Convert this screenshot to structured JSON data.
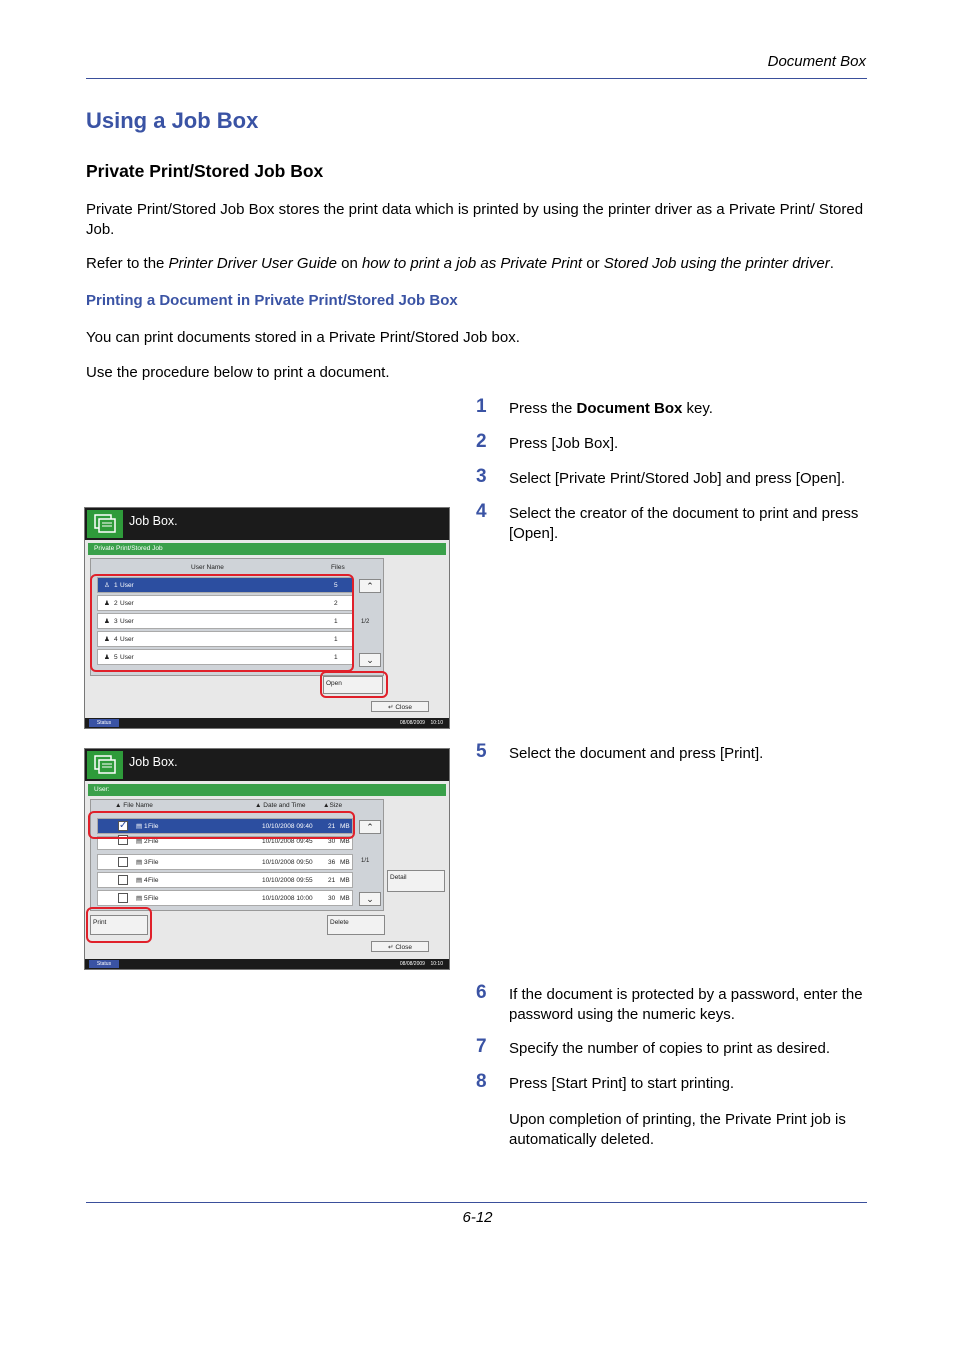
{
  "header": {
    "section": "Document Box"
  },
  "title": "Using a Job Box",
  "subtitle": "Private Print/Stored Job Box",
  "intro": "Private Print/Stored Job Box stores the print data which is printed by using the printer driver as a Private Print/ Stored Job.",
  "refer": {
    "t1": "Refer to the ",
    "guide": "Printer Driver User Guide",
    "t2": " on ",
    "how": "how to print a job as Private Print",
    "t3": " or ",
    "stored": "Stored Job using the printer driver",
    "t4": "."
  },
  "subheading": "Printing a Document in Private Print/Stored Job Box",
  "para1": "You can print documents stored in a Private Print/Stored Job box.",
  "para2": "Use the procedure below to print a document.",
  "steps": [
    {
      "num": "1",
      "pre": "Press the ",
      "bold": "Document Box",
      "post": " key."
    },
    {
      "num": "2",
      "text": "Press [Job Box]."
    },
    {
      "num": "3",
      "text": "Select [Private Print/Stored Job] and press [Open]."
    },
    {
      "num": "4",
      "text": "Select the creator of the document to print and press [Open]."
    },
    {
      "num": "5",
      "text": "Select the document and press [Print]."
    },
    {
      "num": "6",
      "text": "If the document is protected by a password, enter the password using the numeric keys."
    },
    {
      "num": "7",
      "text": "Specify the number of copies to print as desired."
    },
    {
      "num": "8",
      "text": "Press [Start Print] to start printing."
    }
  ],
  "step8_note": "Upon completion of printing, the Private Print job is automatically deleted.",
  "screen1": {
    "title": "Job Box.",
    "bar": "Private Print/Stored Job",
    "col_user": "User Name",
    "col_files": "Files",
    "rows": [
      {
        "num": "1",
        "name": "User",
        "files": "5"
      },
      {
        "num": "2",
        "name": "User",
        "files": "2"
      },
      {
        "num": "3",
        "name": "User",
        "files": "1"
      },
      {
        "num": "4",
        "name": "User",
        "files": "1"
      },
      {
        "num": "5",
        "name": "User",
        "files": "1"
      }
    ],
    "page": "1/2",
    "open": "Open",
    "close": "Close",
    "status": "Status",
    "date": "08/08/2009",
    "time": "10:10"
  },
  "screen2": {
    "title": "Job Box.",
    "bar": "User:",
    "col_name": "File Name",
    "col_date": "Date and Time",
    "col_size": "Size",
    "rows": [
      {
        "num": "1",
        "name": "File",
        "date": "10/10/2008 09:40",
        "size": "21",
        "unit": "MB"
      },
      {
        "num": "2",
        "name": "File",
        "date": "10/10/2008 09:45",
        "size": "30",
        "unit": "MB"
      },
      {
        "num": "3",
        "name": "File",
        "date": "10/10/2008 09:50",
        "size": "36",
        "unit": "MB"
      },
      {
        "num": "4",
        "name": "File",
        "date": "10/10/2008 09:55",
        "size": "21",
        "unit": "MB"
      },
      {
        "num": "5",
        "name": "File",
        "date": "10/10/2008 10:00",
        "size": "30",
        "unit": "MB"
      }
    ],
    "page": "1/1",
    "detail": "Detail",
    "print": "Print",
    "delete": "Delete",
    "close": "Close",
    "status": "Status",
    "date": "08/08/2009",
    "time": "10:10"
  },
  "page_number": "6-12"
}
